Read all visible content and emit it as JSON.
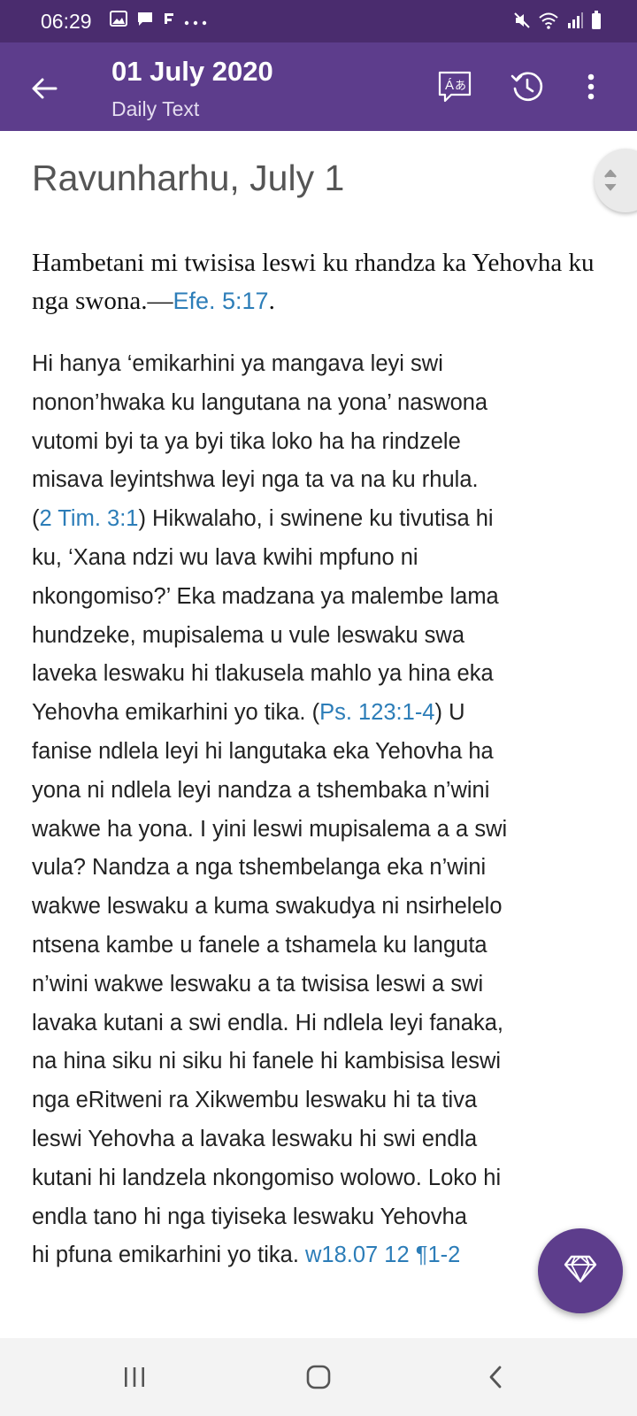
{
  "status_bar": {
    "time": "06:29",
    "left_icons": [
      "image-icon",
      "message-icon",
      "flipboard-icon",
      "more-notifications-icon"
    ],
    "right_icons": [
      "mute-icon",
      "wifi-icon",
      "signal-icon",
      "battery-icon"
    ]
  },
  "app_bar": {
    "title": "01 July 2020",
    "subtitle": "Daily Text",
    "icons": [
      "back-arrow-icon",
      "translate-icon",
      "history-icon",
      "more-vert-icon"
    ],
    "color": "#5d3d8c"
  },
  "article": {
    "day_heading": "Ravunharhu, July 1",
    "theme_text": "Hambetani mi twisisa leswi ku rhandza ka Yehovha ku nga swona.—",
    "theme_ref": "Efe. 5:17",
    "theme_end": ".",
    "lines": [
      {
        "parts": [
          {
            "t": "Hi hanya ‘emikarhini ya mangava leyi swi"
          }
        ]
      },
      {
        "parts": [
          {
            "t": "nonon’hwaka ku langutana na yona’ naswona"
          }
        ]
      },
      {
        "parts": [
          {
            "t": "vutomi byi ta ya byi tika loko ha ha rindzele"
          }
        ]
      },
      {
        "parts": [
          {
            "t": "misava leyintshwa leyi nga ta va na ku rhula."
          }
        ]
      },
      {
        "parts": [
          {
            "t": "("
          },
          {
            "t": "2 Tim. 3:1",
            "link": true
          },
          {
            "t": ") Hikwalaho, i swinene ku tivutisa hi"
          }
        ]
      },
      {
        "parts": [
          {
            "t": "ku, ‘Xana ndzi wu lava kwihi mpfuno ni"
          }
        ]
      },
      {
        "parts": [
          {
            "t": "nkongomiso?’ Eka madzana ya malembe lama"
          }
        ]
      },
      {
        "parts": [
          {
            "t": "hundzeke, mupisalema u vule leswaku swa"
          }
        ]
      },
      {
        "parts": [
          {
            "t": "laveka leswaku hi tlakusela mahlo ya hina eka"
          }
        ]
      },
      {
        "parts": [
          {
            "t": "Yehovha emikarhini yo tika. ("
          },
          {
            "t": "Ps. 123:1-4",
            "link": true
          },
          {
            "t": ") U"
          }
        ]
      },
      {
        "parts": [
          {
            "t": "fanise ndlela leyi hi langutaka eka Yehovha ha"
          }
        ]
      },
      {
        "parts": [
          {
            "t": "yona ni ndlela leyi nandza a tshembaka n’wini"
          }
        ]
      },
      {
        "parts": [
          {
            "t": "wakwe ha yona. I yini leswi mupisalema a a swi"
          }
        ]
      },
      {
        "parts": [
          {
            "t": "vula? Nandza a nga tshembelanga eka n’wini"
          }
        ]
      },
      {
        "parts": [
          {
            "t": "wakwe leswaku a kuma swakudya ni nsirhelelo"
          }
        ]
      },
      {
        "parts": [
          {
            "t": "ntsena kambe u fanele a tshamela ku languta"
          }
        ]
      },
      {
        "parts": [
          {
            "t": "n’wini wakwe leswaku a ta twisisa leswi a swi"
          }
        ]
      },
      {
        "parts": [
          {
            "t": "lavaka kutani a swi endla. Hi ndlela leyi fanaka,"
          }
        ]
      },
      {
        "parts": [
          {
            "t": "na hina siku ni siku hi fanele hi kambisisa leswi"
          }
        ]
      },
      {
        "parts": [
          {
            "t": "nga eRitweni ra Xikwembu leswaku hi ta tiva"
          }
        ]
      },
      {
        "parts": [
          {
            "t": "leswi Yehovha a lavaka leswaku hi swi endla"
          }
        ]
      },
      {
        "parts": [
          {
            "t": "kutani hi landzela nkongomiso wolowo. Loko hi"
          }
        ]
      },
      {
        "parts": [
          {
            "t": "endla tano hi nga tiyiseka leswaku Yehovha"
          }
        ]
      },
      {
        "parts": [
          {
            "t": "hi pfuna emikarhini yo tika. "
          },
          {
            "t": "w18.07 12 ¶1-2",
            "link": true
          }
        ]
      }
    ],
    "link_color": "#2c7db8"
  },
  "fab": {
    "icon": "diamond-icon"
  },
  "nav_bar": {
    "icons": [
      "recent-apps-icon",
      "home-icon",
      "back-icon"
    ]
  }
}
